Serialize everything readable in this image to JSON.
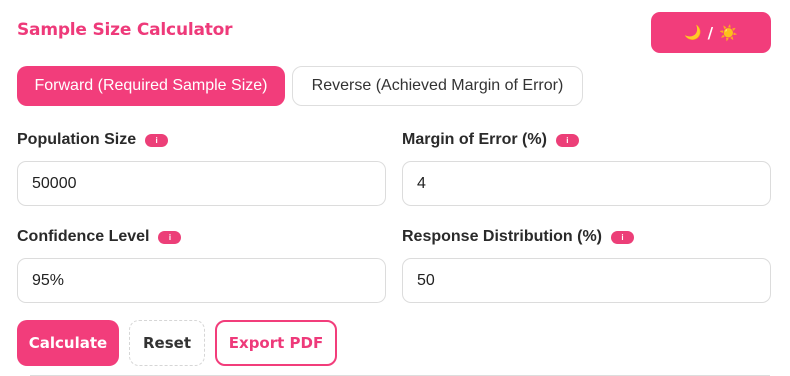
{
  "app": {
    "title": "Sample Size Calculator",
    "theme_toggle": {
      "moon": "🌙",
      "separator": "/",
      "sun": "☀️"
    }
  },
  "modes": {
    "forward": "Forward (Required Sample Size)",
    "reverse": "Reverse (Achieved Margin of Error)",
    "active": "forward"
  },
  "fields": {
    "population_size": {
      "label": "Population Size",
      "value": "50000"
    },
    "margin_of_error": {
      "label": "Margin of Error (%)",
      "value": "4"
    },
    "confidence_level": {
      "label": "Confidence Level",
      "value": "95%"
    },
    "response_distribution": {
      "label": "Response Distribution (%)",
      "value": "50"
    }
  },
  "info_badge": "i",
  "actions": {
    "calculate": "Calculate",
    "reset": "Reset",
    "export": "Export PDF"
  },
  "colors": {
    "accent": "#f23d7b",
    "title": "#ee3a7a",
    "border": "#dcdcdc"
  }
}
